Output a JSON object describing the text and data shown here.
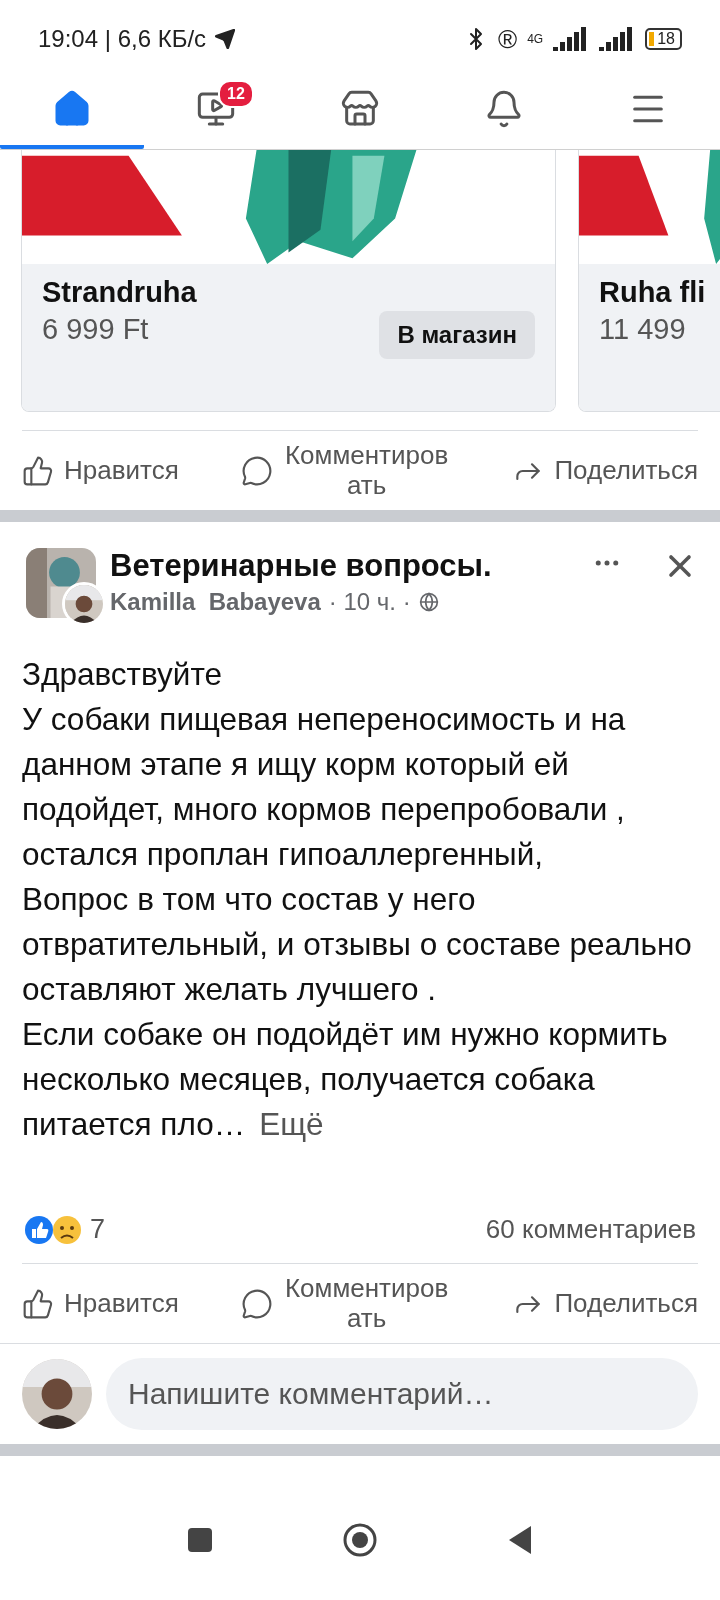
{
  "status_bar": {
    "time": "19:04 | 6,6 КБ/с",
    "network": "4G",
    "roaming": "®",
    "battery": "18"
  },
  "nav_tabs": [
    {
      "kind": "home",
      "selected": true
    },
    {
      "kind": "video",
      "selected": false,
      "badge": "12"
    },
    {
      "kind": "marketplace",
      "selected": false
    },
    {
      "kind": "notifications",
      "selected": false
    },
    {
      "kind": "menu",
      "selected": false
    }
  ],
  "carousel": [
    {
      "title": "Strandruha",
      "price": "6 999 Ft",
      "button": "В магазин"
    },
    {
      "title": "Ruha fli",
      "price": "11 499"
    }
  ],
  "ad_actions": [
    {
      "kind": "like",
      "label": "Нравится"
    },
    {
      "kind": "comment",
      "label": "Комментировать"
    },
    {
      "kind": "share",
      "label": "Поделиться"
    }
  ],
  "post": {
    "group": "Ветеринарные вопросы.",
    "author": "Kamilla  Babayeva",
    "meta": "· 10 ч. ·",
    "body": "Здравствуйте\nУ собаки пищевая непереносимость и на данном этапе я ищу корм который ей подойдет,  много кормов перепробовали , остался проплан гипоаллергенный,\nВопрос в том что состав у него отвратительный, и отзывы о составе реально оставляют желать лучшего .\nЕсли собаке он подойдёт им нужно кормить несколько месяцев, получается собака питается пло…",
    "more": "Ещё",
    "reaction_count": "7",
    "comments_count": "60 комментариев",
    "actions": [
      {
        "kind": "like",
        "label": "Нравится"
      },
      {
        "kind": "comment",
        "label": "Комментировать"
      },
      {
        "kind": "share",
        "label": "Поделиться"
      }
    ],
    "comment_placeholder": "Напишите комментарий…"
  }
}
